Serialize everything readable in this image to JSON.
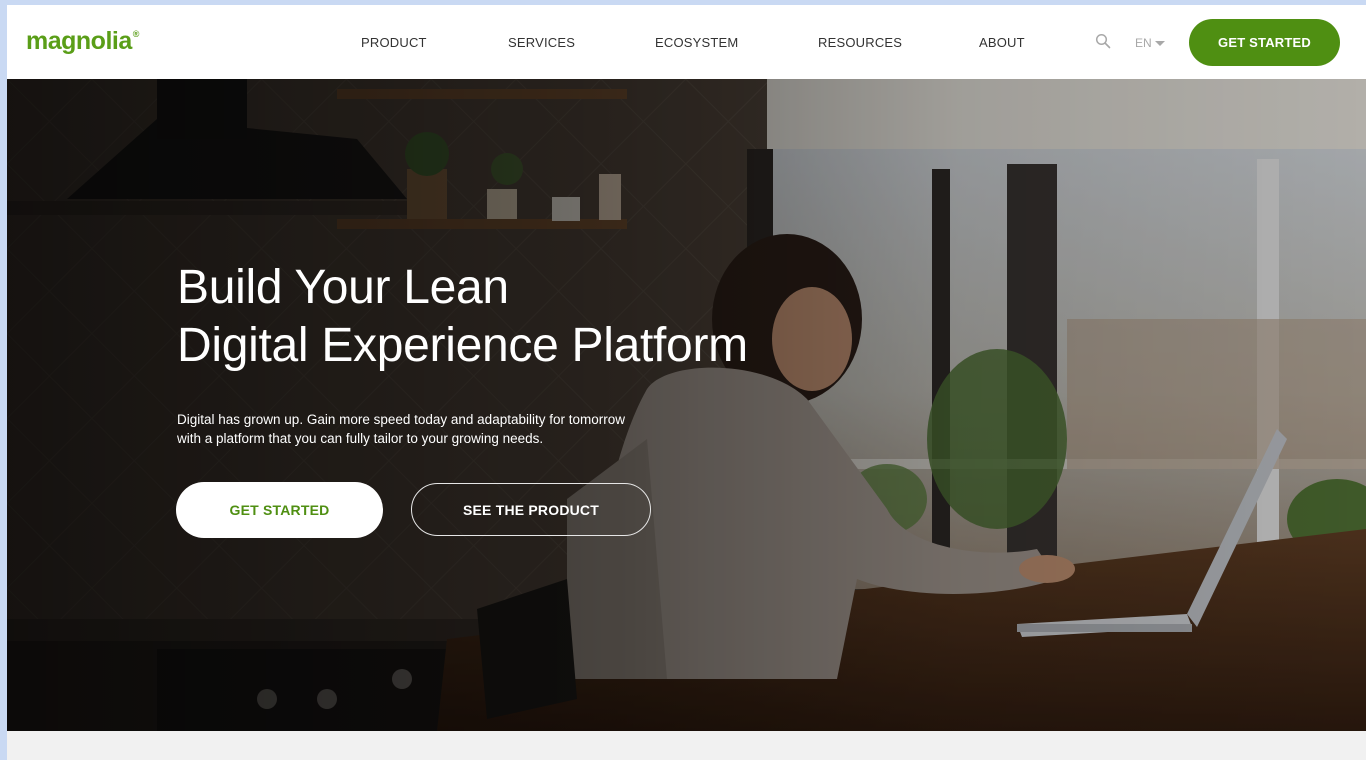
{
  "header": {
    "logo": "magnolia",
    "logo_mark": "®",
    "nav": [
      "PRODUCT",
      "SERVICES",
      "ECOSYSTEM",
      "RESOURCES",
      "ABOUT"
    ],
    "language": "EN",
    "cta_label": "GET STARTED"
  },
  "hero": {
    "title_line1": "Build Your Lean",
    "title_line2": "Digital Experience Platform",
    "subtitle_line1": "Digital has grown up. Gain more speed today and adaptability for tomorrow",
    "subtitle_line2": "with a platform that you can fully tailor to your growing needs.",
    "primary_button": "GET STARTED",
    "secondary_button": "SEE THE PRODUCT"
  },
  "colors": {
    "brand_green": "#4f8f12",
    "logo_green": "#5a9e18",
    "page_background": "#c9d9f3"
  }
}
